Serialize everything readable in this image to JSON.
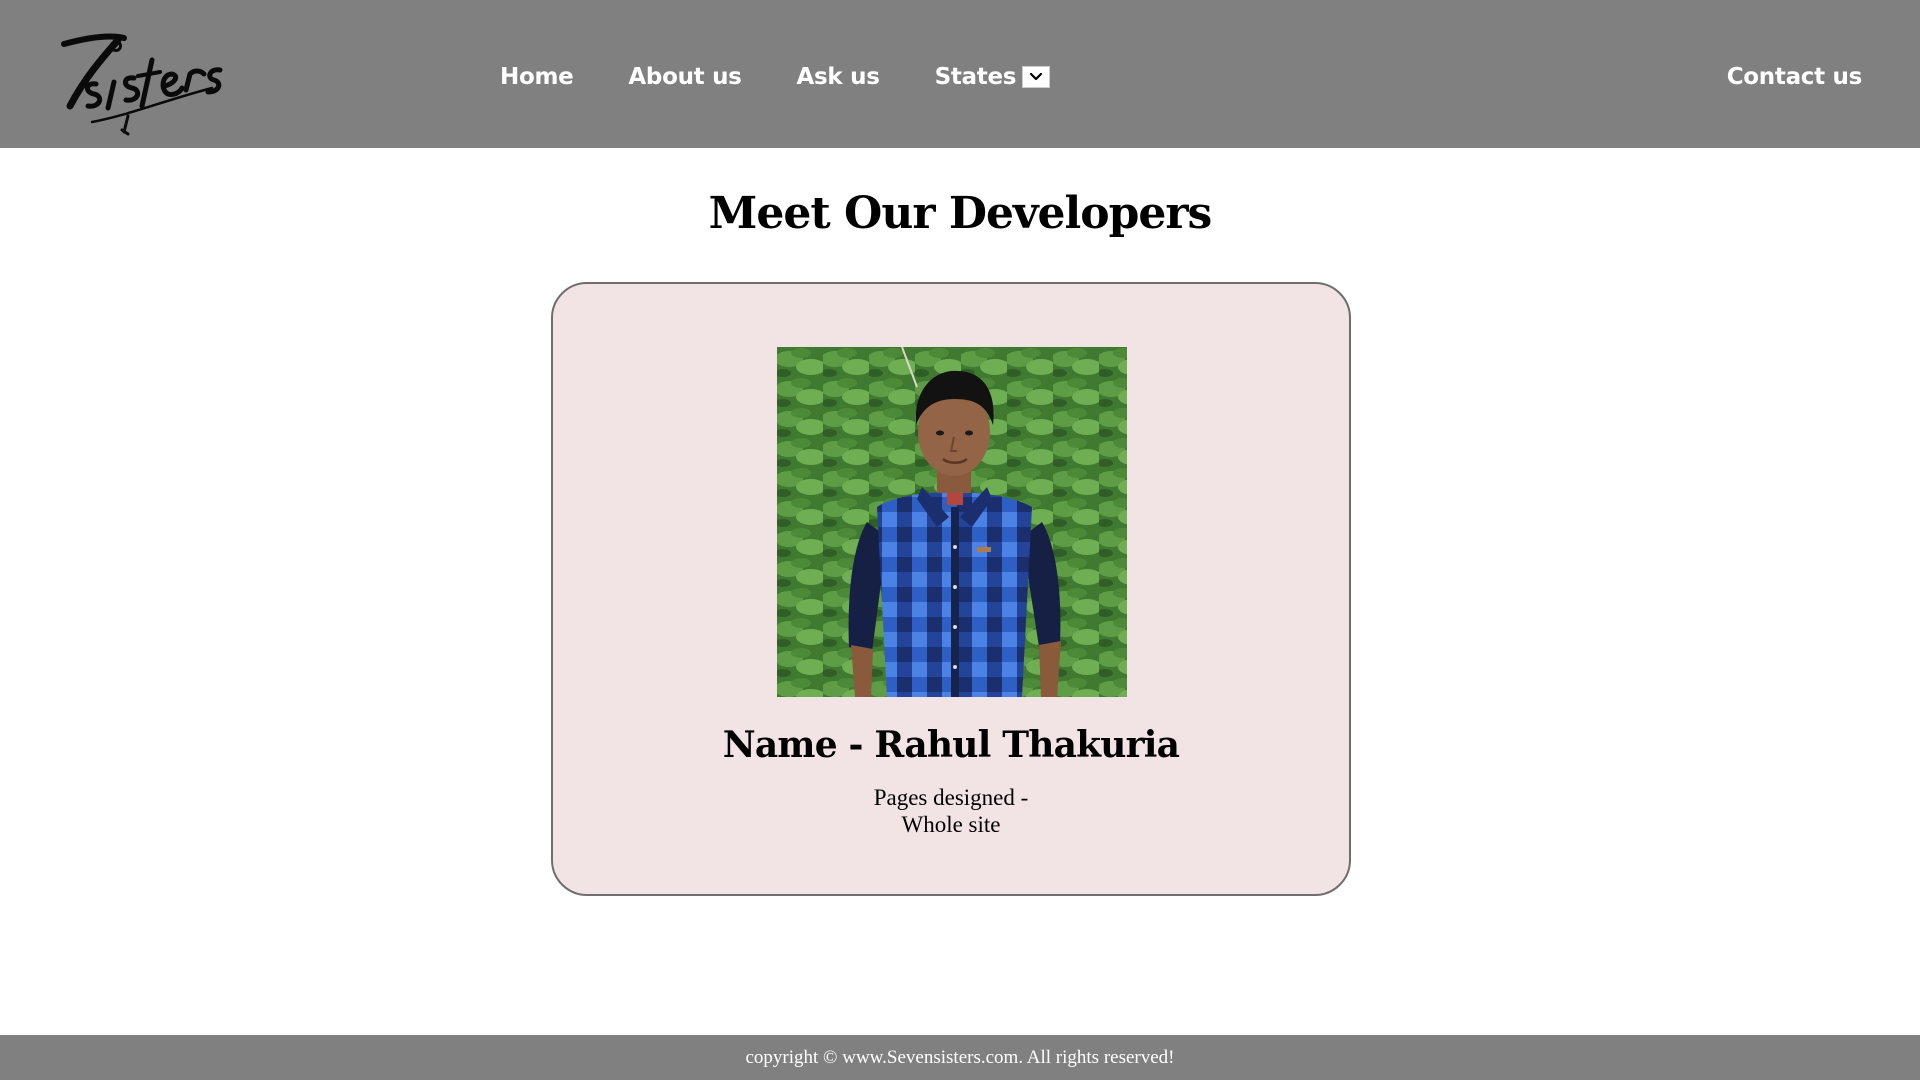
{
  "brand": {
    "logo_text": "7sisters"
  },
  "nav": {
    "items": [
      {
        "label": "Home"
      },
      {
        "label": "About us"
      },
      {
        "label": "Ask us"
      },
      {
        "label": "States"
      }
    ],
    "states_dropdown_icon": "chevron-down-icon",
    "contact": "Contact us"
  },
  "main": {
    "title": "Meet Our Developers",
    "developer": {
      "name": "Name - Rahul Thakuria",
      "pages_line1": "Pages designed -",
      "pages_line2": "Whole site"
    }
  },
  "footer": {
    "text": "copyright © www.Sevensisters.com. All rights reserved!"
  },
  "colors": {
    "navbar_bg": "#808080",
    "card_bg": "#f2e3e5",
    "card_border": "#6e6e6e",
    "footer_bg": "#808080"
  }
}
